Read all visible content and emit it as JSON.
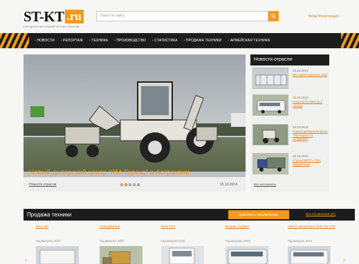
{
  "header": {
    "logo_main": "ST-KT",
    "logo_domain": ".ru",
    "logo_tagline": "СПЕЦИАЛЬНАЯ КОММЕРЧЕСКАЯ ТЕХНИКА",
    "search_placeholder": "Поиск по сайту",
    "login_label": "Вход",
    "register_label": "Регистрация"
  },
  "nav": {
    "items": [
      "НОВОСТИ",
      "РЕПОРТАЖ",
      "ТЕХНИКА",
      "ПРОИЗВОДСТВО",
      "СТАТИСТИКА",
      "ПРОДАЖА ТЕХНИКИ",
      "АРМЕЙСКАЯ ТЕХНИКА"
    ]
  },
  "hero": {
    "title": "Новый дилерский центр \"РМ-Терекс\" в Астрахани",
    "link": "Новости отрасли",
    "date": "15.10.2014",
    "slides_total": 5,
    "slide_active": 2
  },
  "side_news": {
    "heading": "Новости отрасли",
    "items": [
      {
        "date": "16.10.2014",
        "text": "Мотоцикл марки из газа"
      },
      {
        "date": "15.10.2014",
        "text": "КАвЗ-4270, Вектор в города"
      },
      {
        "date": "15.10.2014",
        "text": "Новый дилерский центр \"РМ-Терекс\" в Астрахани"
      },
      {
        "date": "15.10.2014",
        "text": "«Газон NEXT» стал бюджетным"
      }
    ],
    "all_link": "Все материалы"
  },
  "sales": {
    "heading": "Продажа техники",
    "add_button": "ДОБАВИТЬ ОБЪЯВЛЕНИЕ",
    "all_link": "Все объявления (27)",
    "products": [
      {
        "name": "Iveco BP",
        "year": "Год выпуска: 2014"
      },
      {
        "name": "Caterpillar 966",
        "year": "Год выпуска: 2007"
      },
      {
        "name": "MAN TGS",
        "year": "Год выпуска: 2011"
      },
      {
        "name": "Neoplan Cityliner",
        "year": "Год выпуска: 2013"
      },
      {
        "name": "IVECO Menarinibus SFR 154 ZTE",
        "year": "Год выпуска: 2014"
      }
    ]
  },
  "colors": {
    "accent": "#f39a1e",
    "dark": "#1c1c1c"
  }
}
